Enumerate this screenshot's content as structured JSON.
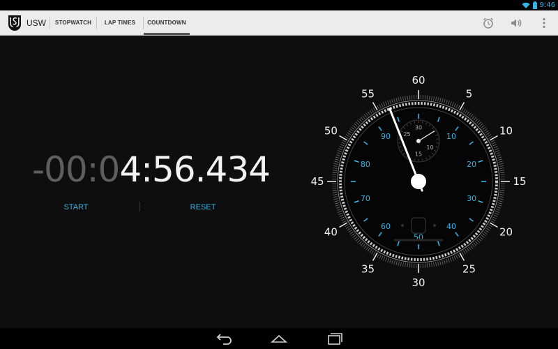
{
  "status_bar": {
    "time": "9:46",
    "icons": [
      "wifi-icon",
      "battery-icon"
    ]
  },
  "action_bar": {
    "app_title": "USW",
    "logo": "usw-logo",
    "tabs": [
      {
        "label": "STOPWATCH",
        "selected": false
      },
      {
        "label": "LAP TIMES",
        "selected": false
      },
      {
        "label": "COUNTDOWN",
        "selected": true
      }
    ],
    "actions": [
      "alarm-icon",
      "volume-icon",
      "overflow-menu-icon"
    ]
  },
  "countdown": {
    "prefix_dim": "-00:0",
    "remaining": "4:56.434",
    "start_label": "START",
    "reset_label": "RESET"
  },
  "dial": {
    "outer_labels": [
      "60",
      "5",
      "10",
      "15",
      "20",
      "25",
      "30",
      "35",
      "40",
      "45",
      "50",
      "55"
    ],
    "inner_labels": [
      "10",
      "20",
      "30",
      "40",
      "50",
      "60",
      "70",
      "80",
      "90"
    ],
    "sub_dial_labels": [
      "30",
      "10",
      "15",
      "25"
    ],
    "main_hand_seconds": 56.4,
    "colors": {
      "accent": "#33b5e5",
      "text": "#f2f2f2",
      "dim": "#5e5e5e"
    }
  },
  "nav_bar": {
    "buttons": [
      "back-icon",
      "home-icon",
      "recents-icon"
    ]
  }
}
